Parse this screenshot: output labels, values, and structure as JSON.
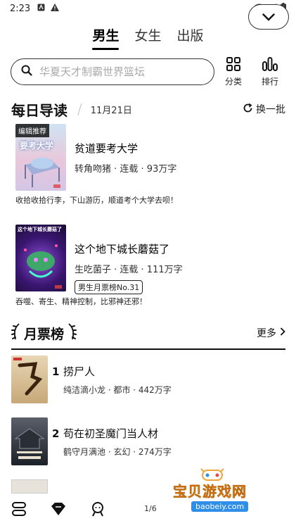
{
  "status_bar": {
    "time": "2:23"
  },
  "gender_tabs": [
    {
      "label": "男生",
      "active": true
    },
    {
      "label": "女生",
      "active": false
    },
    {
      "label": "出版",
      "active": false
    }
  ],
  "search": {
    "placeholder": "华夏天才制霸世界篮坛"
  },
  "top_actions": {
    "category_label": "分类",
    "ranking_label": "排行"
  },
  "daily": {
    "title": "每日导读",
    "separator": "/",
    "date": "11月21日",
    "refresh_label": "换一批",
    "books": [
      {
        "tag": "编辑推荐",
        "cover_text": "要考大学",
        "title": "贫道要考大学",
        "meta": "转角吻猪 · 连载 · 93万字",
        "badge": "",
        "desc": "收拾收拾行李，下山游历，顺道考个大学去呗！"
      },
      {
        "tag": "",
        "cover_text": "这个地下城长蘑菇了",
        "title": "这个地下城长蘑菇了",
        "meta": "生吃菌子 · 连载 · 111万字",
        "badge": "男生月票榜No.31",
        "desc": "吞噬、寄生、精神控制，比邪神还邪！"
      }
    ]
  },
  "ranking": {
    "title": "月票榜",
    "more_label": "更多",
    "items": [
      {
        "rank": "1",
        "title": "捞尸人",
        "meta": "纯洁滴小龙 · 都市 · 442万字"
      },
      {
        "rank": "2",
        "title": "苟在初圣魔门当人材",
        "meta": "鹤守月满池 · 玄幻 · 274万字"
      }
    ]
  },
  "bottom": {
    "page_indicator": "1/6"
  },
  "watermark": {
    "text": "宝贝游戏网",
    "url": "baobeiy.com"
  },
  "colors": {
    "accent": "#000000",
    "watermark_orange": "#f1a43a",
    "watermark_blue": "#2f8fe8"
  }
}
